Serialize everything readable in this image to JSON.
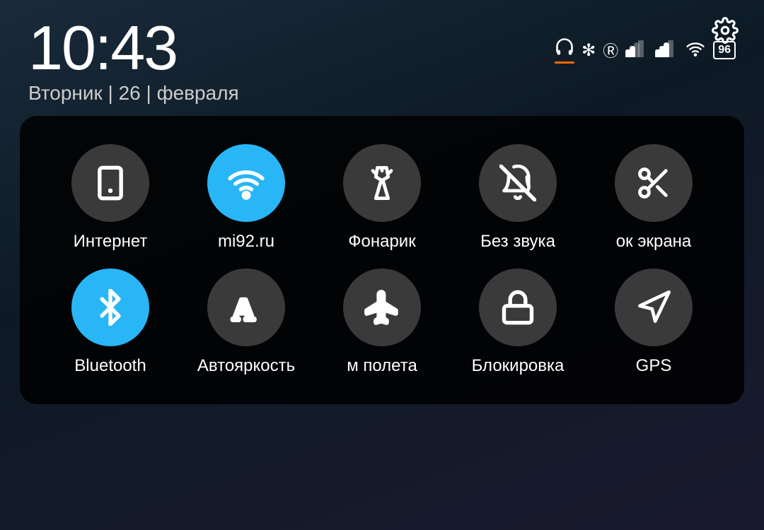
{
  "statusBar": {
    "time": "10:43",
    "date": "Вторник | 26 | февраля",
    "battery": "96",
    "gearLabel": "⚙"
  },
  "tiles": [
    {
      "id": "internet",
      "label": "Интернет",
      "active": false,
      "icon": "data-mobile"
    },
    {
      "id": "wifi",
      "label": "mi92.ru",
      "active": true,
      "icon": "wifi"
    },
    {
      "id": "flashlight",
      "label": "Фонарик",
      "active": false,
      "icon": "flashlight"
    },
    {
      "id": "silent",
      "label": "Без звука",
      "active": false,
      "icon": "bell-off"
    },
    {
      "id": "screenshot",
      "label": "ок экрана",
      "active": false,
      "icon": "scissors"
    },
    {
      "id": "bluetooth",
      "label": "Bluetooth",
      "active": true,
      "icon": "bluetooth"
    },
    {
      "id": "brightness",
      "label": "Автояркость",
      "active": false,
      "icon": "font"
    },
    {
      "id": "airplane",
      "label": "м полета",
      "active": false,
      "icon": "airplane"
    },
    {
      "id": "lock",
      "label": "Блокировка",
      "active": false,
      "icon": "lock"
    },
    {
      "id": "gps",
      "label": "GPS",
      "active": false,
      "icon": "navigation"
    }
  ]
}
